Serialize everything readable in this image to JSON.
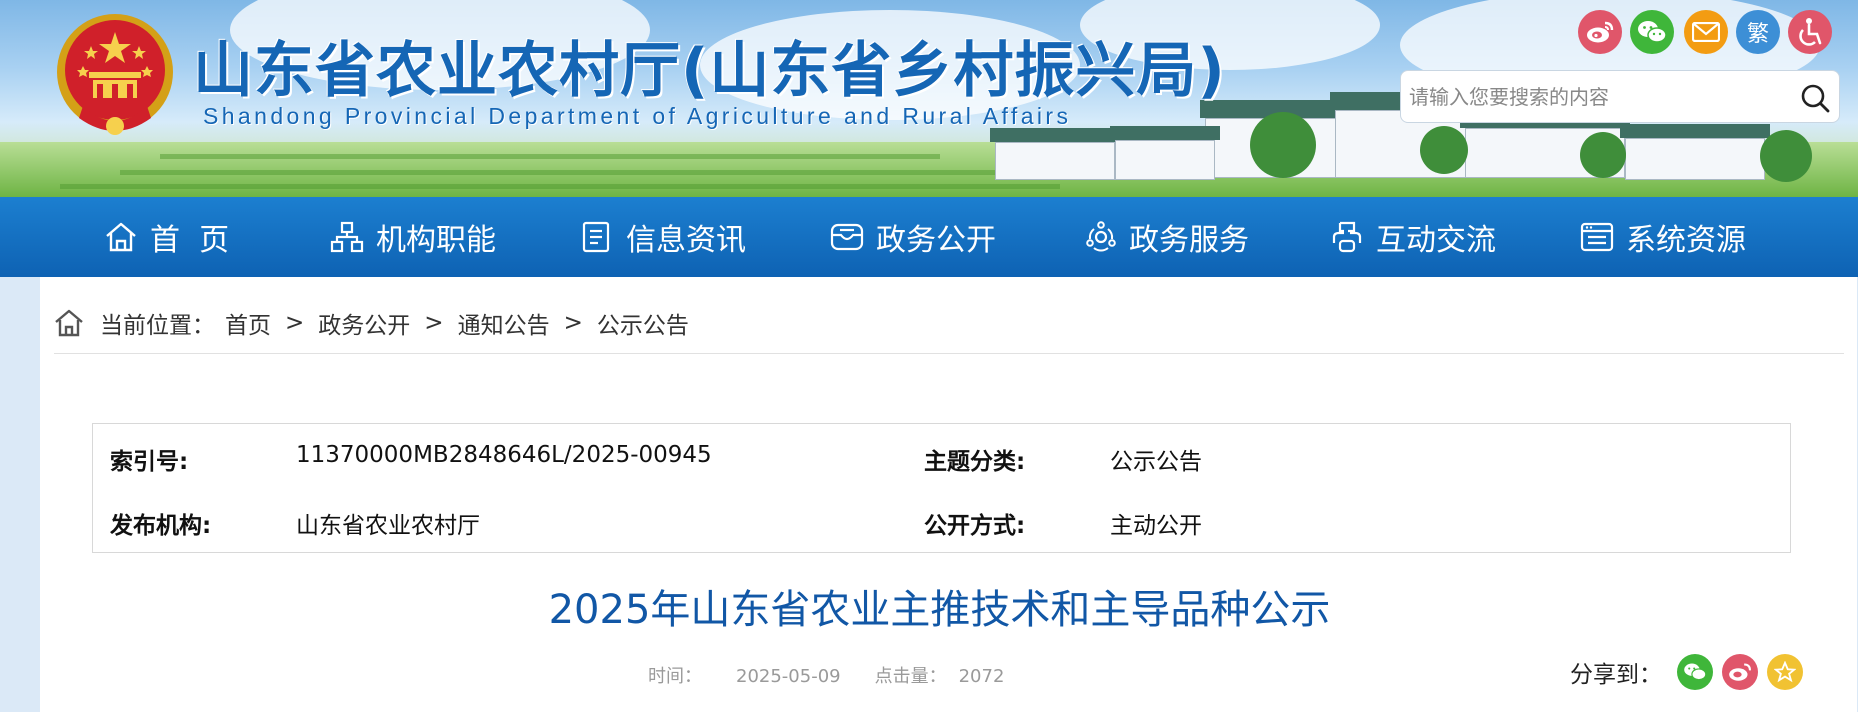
{
  "header": {
    "title": "山东省农业农村厅(山东省乡村振兴局)",
    "subtitle": "Shandong Provincial Department of Agriculture and Rural Affairs",
    "social": [
      {
        "name": "weibo-icon",
        "color": "#e0566a"
      },
      {
        "name": "wechat-icon",
        "color": "#3fb63a"
      },
      {
        "name": "mail-icon",
        "color": "#f39c12"
      },
      {
        "name": "traditional-chinese-icon",
        "color": "#3d8fd6",
        "label": "繁"
      },
      {
        "name": "accessibility-icon",
        "color": "#e0566a"
      }
    ],
    "search": {
      "placeholder": "请输入您要搜索的内容"
    }
  },
  "nav": {
    "items": [
      {
        "label": "首  页",
        "icon": "home-icon"
      },
      {
        "label": "机构职能",
        "icon": "org-chart-icon"
      },
      {
        "label": "信息资讯",
        "icon": "document-icon"
      },
      {
        "label": "政务公开",
        "icon": "inbox-icon"
      },
      {
        "label": "政务服务",
        "icon": "service-icon"
      },
      {
        "label": "互动交流",
        "icon": "interaction-icon"
      },
      {
        "label": "系统资源",
        "icon": "system-icon"
      }
    ]
  },
  "breadcrumb": {
    "prefix": "当前位置：",
    "items": [
      "首页",
      "政务公开",
      "通知公告",
      "公示公告"
    ],
    "separator": ">"
  },
  "meta": {
    "index_label": "索引号:",
    "index_value": "11370000MB2848646L/2025-00945",
    "topic_label": "主题分类:",
    "topic_value": "公示公告",
    "org_label": "发布机构:",
    "org_value": "山东省农业农村厅",
    "mode_label": "公开方式:",
    "mode_value": "主动公开"
  },
  "article": {
    "title": "2025年山东省农业主推技术和主导品种公示",
    "time_label": "时间：",
    "time_value": "2025-05-09",
    "hits_label": "点击量：",
    "hits_value": "2072",
    "share_label": "分享到："
  },
  "colors": {
    "nav_bg": "#0e62b3",
    "title_blue": "#1157a6",
    "brand_blue": "#1566b5"
  }
}
